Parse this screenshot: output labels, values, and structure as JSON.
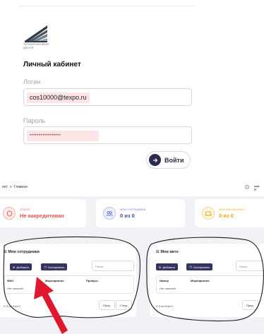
{
  "login": {
    "logo_text": "ТЕРМОРИЗОВОЙ\nЦЕНТР",
    "title": "Личный кабинет",
    "login_label": "Логин",
    "login_value": "cos10000@texpo.ru",
    "password_label": "Пароль",
    "password_value": "•••••••••••••••••",
    "submit_label": "Войти",
    "submit_icon": "arrow-right-icon"
  },
  "dashboard": {
    "breadcrumb": {
      "prev": "ент",
      "separator": ">",
      "current": "Главная"
    },
    "user_short": "ооо\nП",
    "stats": [
      {
        "title": "СТАТУС",
        "value": "Не аккредитован",
        "icon": "shield-icon"
      },
      {
        "title": "МОИ СОТРУДНИКИ",
        "value": "0 из 0",
        "icon": "people-icon"
      },
      {
        "title": "МОИ АВТОМОБИЛИ",
        "value": "0 из 0",
        "icon": "car-icon"
      }
    ],
    "employees": {
      "title": "Мои сотрудники",
      "add_label": "Добавить",
      "copy_label": "Скопировать",
      "search_placeholder": "Поиск",
      "columns": [
        "ФИО",
        "Мероприятие",
        "Пропуск"
      ],
      "empty_text": "Нет записей",
      "count": "С 0 по 0 из 0",
      "prev_label": "Пред.",
      "next_label": "След."
    },
    "cars": {
      "title": "Мои авто",
      "add_label": "Добавить",
      "copy_label": "Скопировать",
      "search_placeholder": "Поиск",
      "columns": [
        "Номер",
        "Мероприятие"
      ],
      "empty_text": "Нет записей",
      "count": "С 0 по 0 из 0",
      "prev_label": "Пред."
    }
  },
  "colors": {
    "accent": "#343461",
    "annotation_red": "#e0182d",
    "field_highlight": "#fde4e6"
  }
}
